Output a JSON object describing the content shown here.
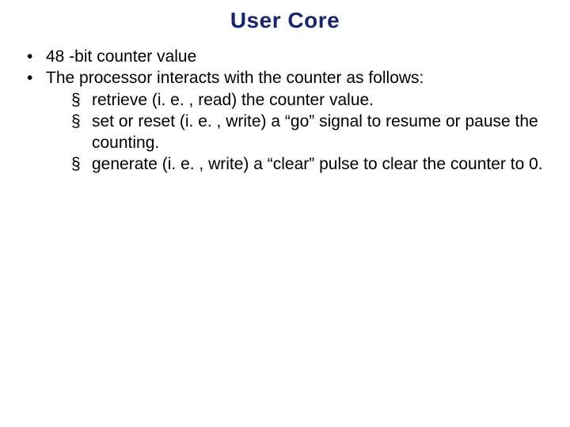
{
  "title": "User Core",
  "bullets": {
    "b1": "48 -bit counter value",
    "b2": "The processor interacts with the counter as follows:",
    "sub": {
      "s1": "retrieve (i. e. , read) the counter value.",
      "s2": "set or reset (i. e. , write) a “go” signal to resume or pause the counting.",
      "s3": "generate (i. e. , write) a “clear” pulse to clear the counter to 0."
    }
  }
}
